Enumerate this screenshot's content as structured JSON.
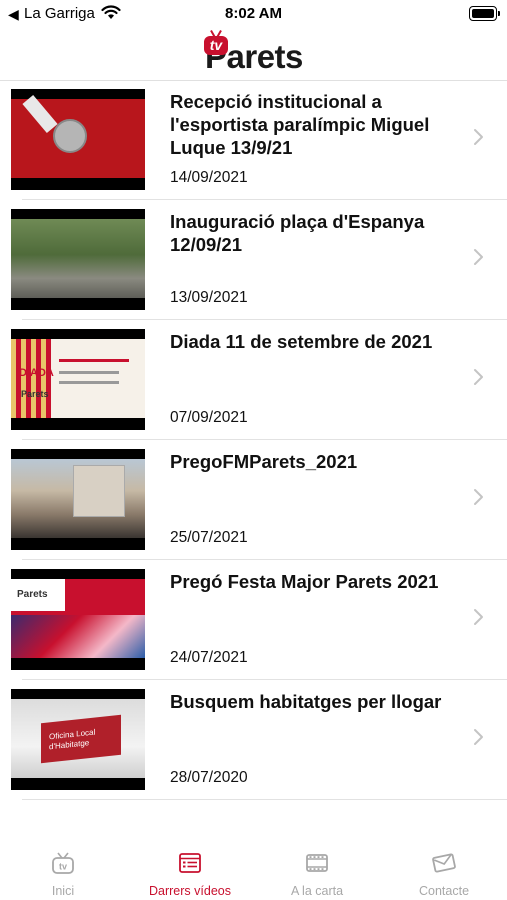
{
  "status_bar": {
    "back_glyph": "◀",
    "carrier": "La Garriga",
    "time": "8:02 AM"
  },
  "header": {
    "logo_badge": "tv",
    "logo_text": "Parets"
  },
  "videos": [
    {
      "title": "Recepció institucional a l'esportista paralímpic Miguel Luque 13/9/21",
      "date": "14/09/2021"
    },
    {
      "title": "Inauguració plaça d'Espanya 12/09/21",
      "date": "13/09/2021"
    },
    {
      "title": "Diada 11 de setembre de 2021",
      "date": "07/09/2021"
    },
    {
      "title": "PregoFMParets_2021",
      "date": "25/07/2021"
    },
    {
      "title": "Pregó Festa Major Parets 2021",
      "date": "24/07/2021"
    },
    {
      "title": "Busquem habitatges per llogar",
      "date": "28/07/2020"
    }
  ],
  "thumb_text": {
    "diada": "DIADA",
    "parets_small": "Parets",
    "parets_red": "Parets",
    "oficina": "Oficina Local d'Habitatge"
  },
  "tabs": [
    {
      "label": "Inici",
      "icon": "tv-icon",
      "active": false
    },
    {
      "label": "Darrers vídeos",
      "icon": "video-list-icon",
      "active": true
    },
    {
      "label": "A la carta",
      "icon": "film-icon",
      "active": false
    },
    {
      "label": "Contacte",
      "icon": "mail-icon",
      "active": false
    }
  ],
  "colors": {
    "accent": "#c8102e",
    "inactive": "#a8a8a8"
  }
}
